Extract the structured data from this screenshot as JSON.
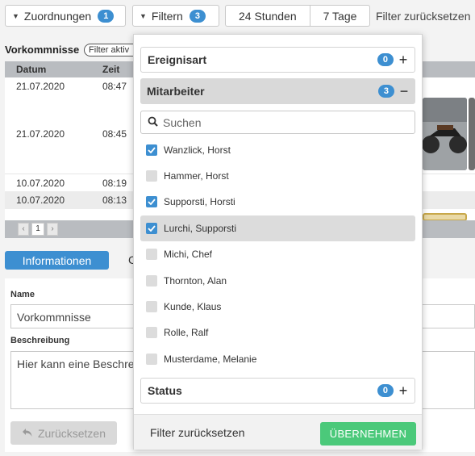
{
  "toolbar": {
    "assignments_label": "Zuordnungen",
    "assignments_count": "1",
    "filter_label": "Filtern",
    "filter_count": "3",
    "range_24h": "24 Stunden",
    "range_7d": "7 Tage",
    "reset_filter": "Filter zurücksetzen"
  },
  "incidents": {
    "title": "Vorkommnisse",
    "filter_chip": "Filter aktiv",
    "columns": {
      "date": "Datum",
      "time": "Zeit"
    },
    "rows": [
      {
        "date": "21.07.2020",
        "time": "08:47"
      },
      {
        "date": "21.07.2020",
        "time": "08:45"
      },
      {
        "date": "10.07.2020",
        "time": "08:19"
      },
      {
        "date": "10.07.2020",
        "time": "08:13"
      }
    ],
    "pager": {
      "prev": "‹",
      "page": "1",
      "next": "›"
    }
  },
  "tabs": {
    "active": "Informationen",
    "other": "C"
  },
  "form": {
    "name_label": "Name",
    "name_value": "Vorkommnisse",
    "desc_label": "Beschreibung",
    "desc_value": "Hier kann eine Beschreibung",
    "reset_label": "Zurücksetzen"
  },
  "dropdown": {
    "event_type": {
      "label": "Ereignisart",
      "count": "0",
      "toggle": "+"
    },
    "employees": {
      "label": "Mitarbeiter",
      "count": "3",
      "toggle": "−"
    },
    "search_placeholder": "Suchen",
    "employees_list": [
      {
        "name": "Wanzlick, Horst",
        "checked": true
      },
      {
        "name": "Hammer, Horst",
        "checked": false
      },
      {
        "name": "Supporsti, Horsti",
        "checked": true
      },
      {
        "name": "Lurchi, Supporsti",
        "checked": true
      },
      {
        "name": "Michi, Chef",
        "checked": false
      },
      {
        "name": "Thornton, Alan",
        "checked": false
      },
      {
        "name": "Kunde, Klaus",
        "checked": false
      },
      {
        "name": "Rolle, Ralf",
        "checked": false
      },
      {
        "name": "Musterdame, Melanie",
        "checked": false
      }
    ],
    "status": {
      "label": "Status",
      "count": "0",
      "toggle": "+"
    },
    "footer_reset": "Filter zurücksetzen",
    "apply": "ÜBERNEHMEN"
  },
  "colors": {
    "accent": "#3d8fd1",
    "apply": "#4bc97a",
    "header_gray": "#b9bcc0"
  }
}
